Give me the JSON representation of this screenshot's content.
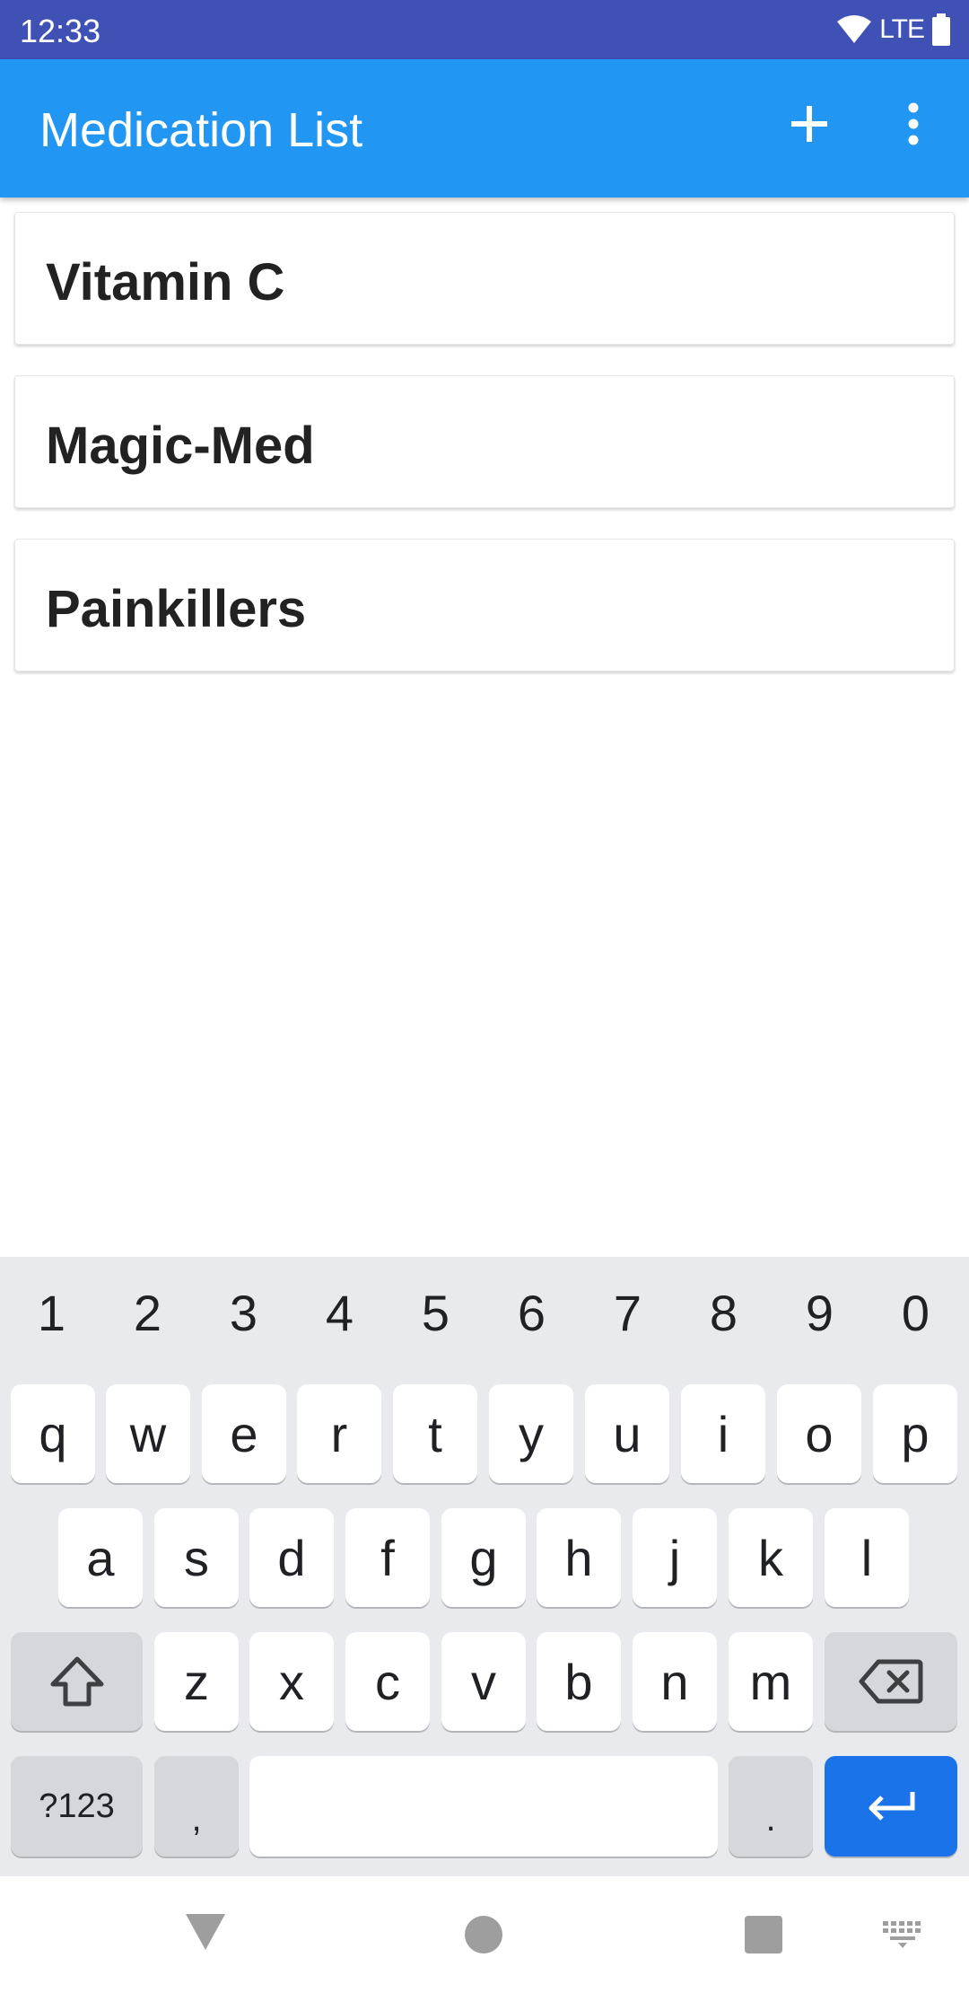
{
  "status_bar": {
    "time": "12:33",
    "network_label": "LTE",
    "icons": [
      "wifi-icon",
      "signal-icon",
      "battery-icon"
    ]
  },
  "app_bar": {
    "title": "Medication List",
    "actions": [
      "add-icon",
      "more-vert-icon"
    ]
  },
  "medications": [
    {
      "name": "Vitamin C"
    },
    {
      "name": "Magic-Med"
    },
    {
      "name": "Painkillers"
    }
  ],
  "keyboard": {
    "number_row": [
      "1",
      "2",
      "3",
      "4",
      "5",
      "6",
      "7",
      "8",
      "9",
      "0"
    ],
    "row1": [
      "q",
      "w",
      "e",
      "r",
      "t",
      "y",
      "u",
      "i",
      "o",
      "p"
    ],
    "row2": [
      "a",
      "s",
      "d",
      "f",
      "g",
      "h",
      "j",
      "k",
      "l"
    ],
    "row3": [
      "z",
      "x",
      "c",
      "v",
      "b",
      "n",
      "m"
    ],
    "symbols_label": "?123",
    "comma_label": ",",
    "period_label": ".",
    "icons": [
      "shift-icon",
      "backspace-icon",
      "enter-icon"
    ]
  },
  "nav_bar": {
    "icons": [
      "back-icon",
      "home-icon",
      "recents-icon",
      "keyboard-switch-icon"
    ]
  },
  "colors": {
    "status_bar": "#3f51b5",
    "app_bar": "#2196f3",
    "enter_key": "#1a73e8",
    "keyboard_bg": "#e8eaed"
  }
}
